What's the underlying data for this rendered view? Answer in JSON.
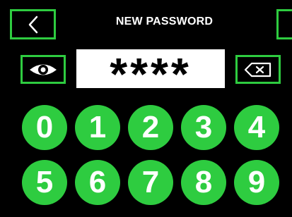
{
  "header": {
    "title": "NEW PASSWORD",
    "back_icon": "chevron-left-icon"
  },
  "password": {
    "masked_value": "****",
    "visibility_icon": "eye-icon",
    "delete_icon": "backspace-icon"
  },
  "keypad": {
    "keys": [
      "0",
      "1",
      "2",
      "3",
      "4",
      "5",
      "6",
      "7",
      "8",
      "9"
    ]
  },
  "colors": {
    "background": "#000000",
    "accent": "#2ecc40",
    "text": "#ffffff",
    "display_background": "#ffffff"
  }
}
